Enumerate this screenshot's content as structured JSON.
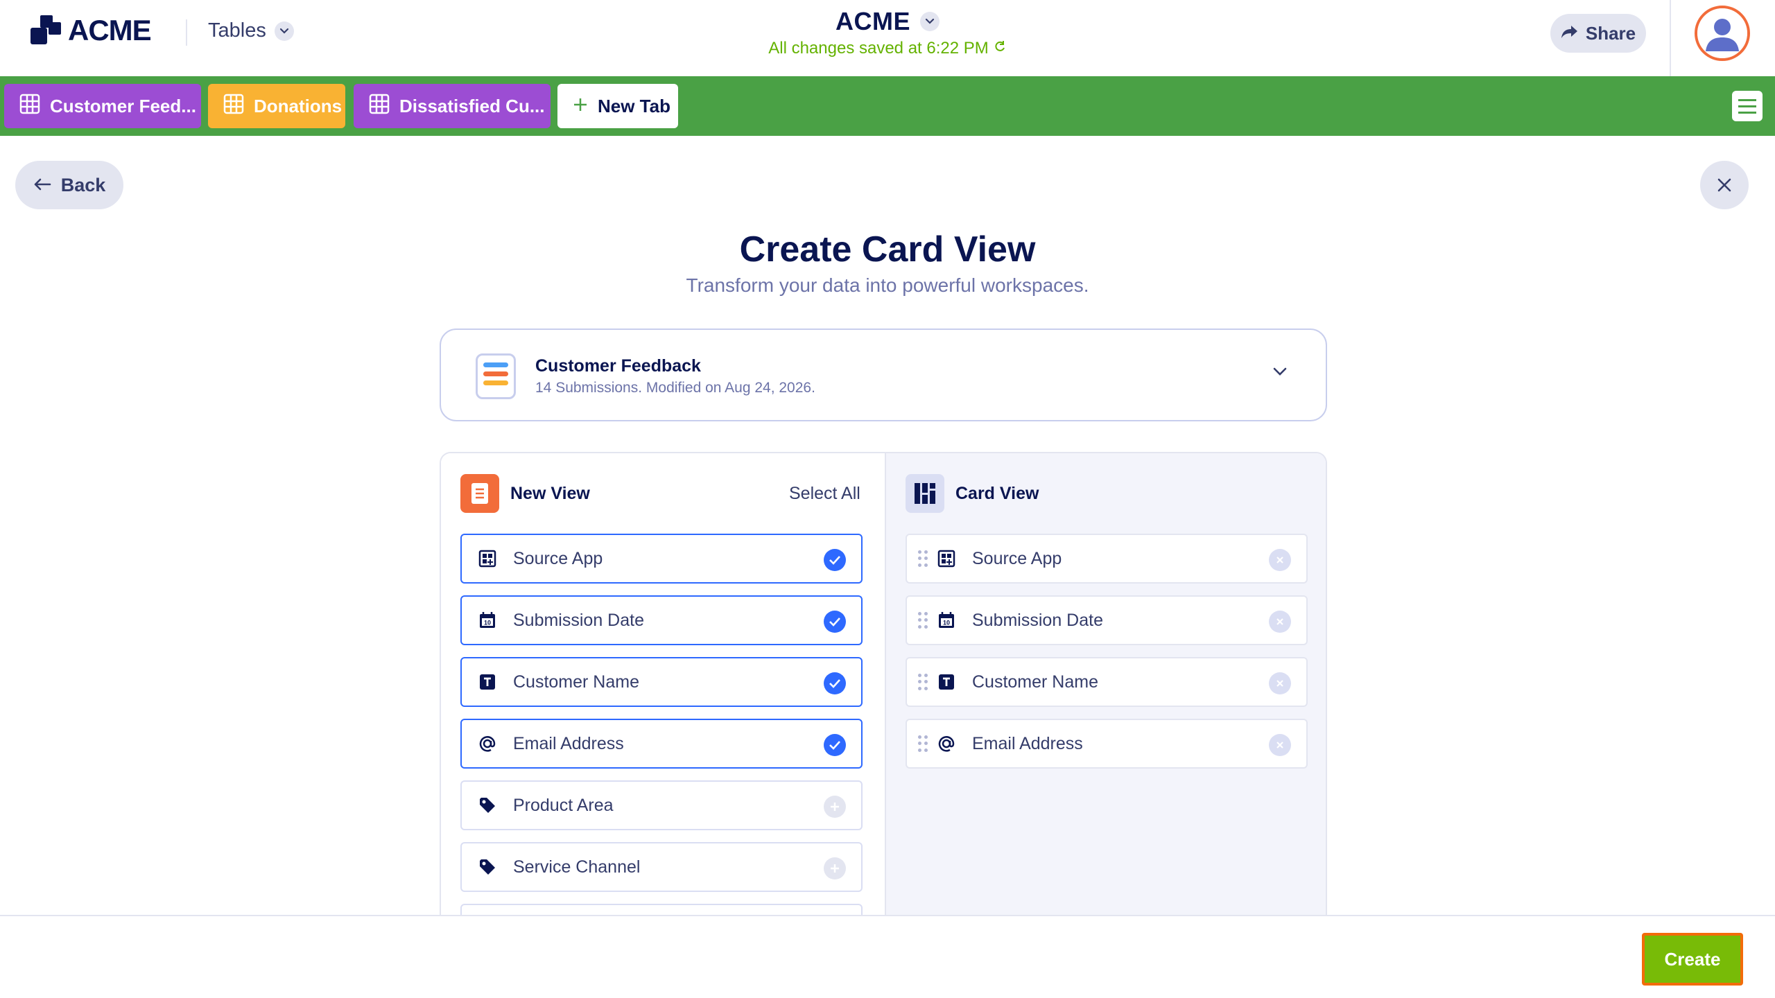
{
  "header": {
    "logo_text": "ACME",
    "tables_label": "Tables",
    "title": "ACME",
    "save_status": "All changes saved at 6:22 PM",
    "share_label": "Share"
  },
  "tabs": [
    {
      "label": "Customer Feed...",
      "color": "#9c4dd3"
    },
    {
      "label": "Donations",
      "color": "#f9b233"
    },
    {
      "label": "Dissatisfied Cu...",
      "color": "#9c4dd3"
    }
  ],
  "new_tab_label": "New Tab",
  "page": {
    "back_label": "Back",
    "title": "Create Card View",
    "subtitle": "Transform your data into powerful workspaces."
  },
  "source": {
    "name": "Customer Feedback",
    "meta": "14 Submissions. Modified on Aug 24, 2026."
  },
  "left_panel": {
    "title": "New View",
    "select_all_label": "Select All",
    "fields": [
      {
        "label": "Source App",
        "icon": "grid-add-icon",
        "selected": true
      },
      {
        "label": "Submission Date",
        "icon": "calendar-icon",
        "selected": true
      },
      {
        "label": "Customer Name",
        "icon": "text-t-icon",
        "selected": true
      },
      {
        "label": "Email Address",
        "icon": "at-sign-icon",
        "selected": true
      },
      {
        "label": "Product Area",
        "icon": "tag-icon",
        "selected": false
      },
      {
        "label": "Service Channel",
        "icon": "tag-icon",
        "selected": false
      }
    ]
  },
  "right_panel": {
    "title": "Card View",
    "fields": [
      {
        "label": "Source App",
        "icon": "grid-add-icon"
      },
      {
        "label": "Submission Date",
        "icon": "calendar-icon"
      },
      {
        "label": "Customer Name",
        "icon": "text-t-icon"
      },
      {
        "label": "Email Address",
        "icon": "at-sign-icon"
      }
    ]
  },
  "footer": {
    "create_label": "Create"
  },
  "colors": {
    "brand_navy": "#0a1551",
    "tab_bar_green": "#4aa145",
    "select_blue": "#2e69ff",
    "create_green": "#78bb07",
    "create_outline_orange": "#f26c0a"
  }
}
